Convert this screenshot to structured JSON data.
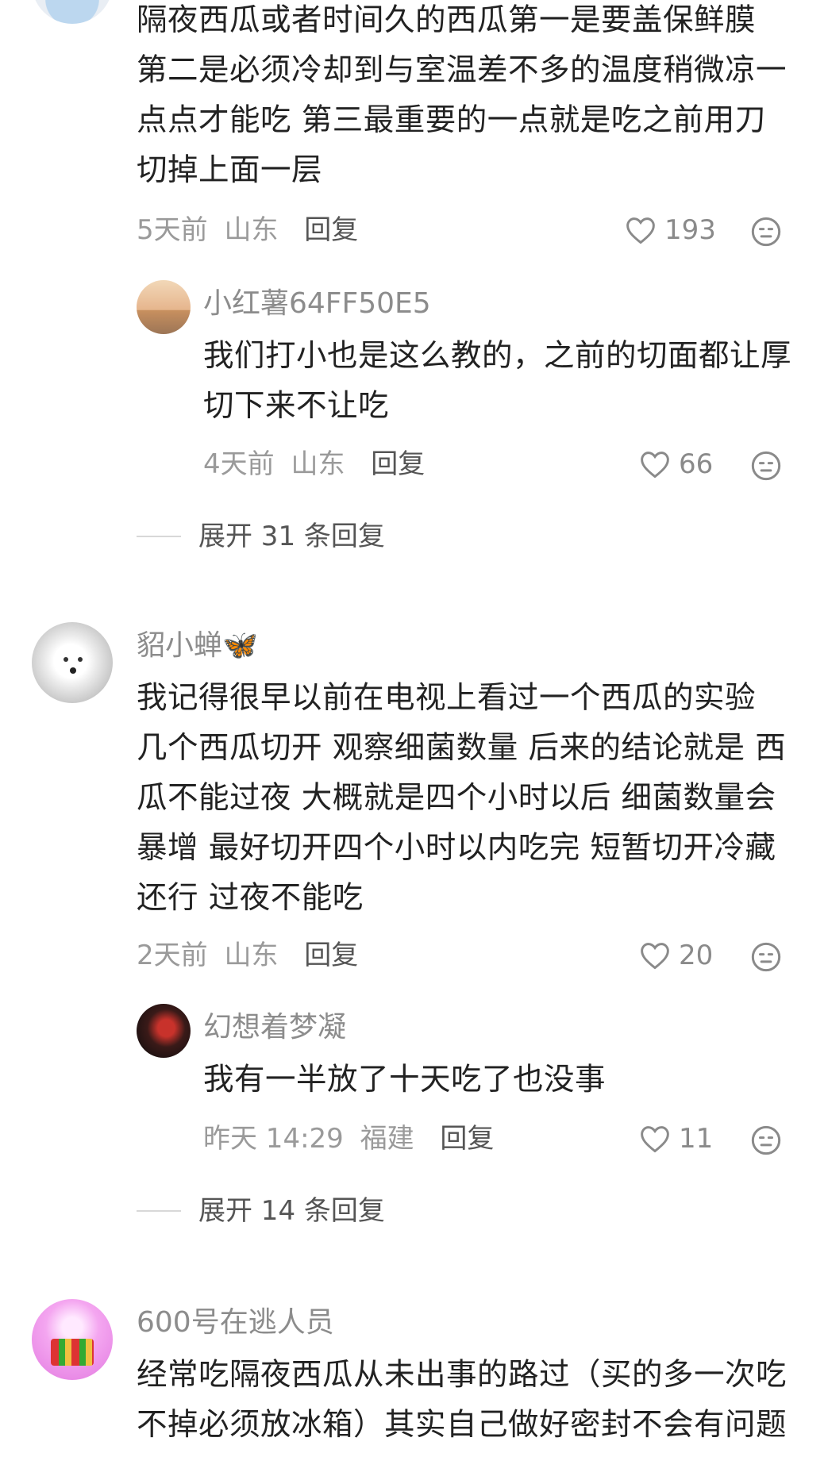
{
  "comments": [
    {
      "content_lines": [
        "隔夜西瓜或者时间久的西瓜第一是要盖保鲜膜",
        "第二是必须冷却到与室温差不多的温度稍微凉一",
        "点点才能吃 第三最重要的一点就是吃之前用刀",
        "切掉上面一层"
      ],
      "time": "5天前",
      "location": "山东",
      "reply_label": "回复",
      "likes": "193",
      "replies": [
        {
          "username": "小红薯64FF50E5",
          "content_lines": [
            "我们打小也是这么教的，之前的切面都让厚",
            "切下来不让吃"
          ],
          "time": "4天前",
          "location": "山东",
          "reply_label": "回复",
          "likes": "66"
        }
      ],
      "expand_label": "展开 31 条回复"
    },
    {
      "username": "貂小蝉🦋",
      "content_lines": [
        "我记得很早以前在电视上看过一个西瓜的实验",
        "几个西瓜切开 观察细菌数量 后来的结论就是 西",
        "瓜不能过夜 大概就是四个小时以后 细菌数量会",
        "暴增 最好切开四个小时以内吃完 短暂切开冷藏",
        "还行 过夜不能吃"
      ],
      "time": "2天前",
      "location": "山东",
      "reply_label": "回复",
      "likes": "20",
      "replies": [
        {
          "username": "幻想着梦凝",
          "content_lines": [
            "我有一半放了十天吃了也没事"
          ],
          "time": "昨天 14:29",
          "location": "福建",
          "reply_label": "回复",
          "likes": "11"
        }
      ],
      "expand_label": "展开 14 条回复"
    },
    {
      "username": "600号在逃人员",
      "content_lines": [
        "经常吃隔夜西瓜从未出事的路过（买的多一次吃",
        "不掉必须放冰箱）其实自己做好密封不会有问题"
      ]
    }
  ],
  "colors": {
    "text": "#222222",
    "muted": "#9a9a9a",
    "icon": "#8a8a8a"
  }
}
